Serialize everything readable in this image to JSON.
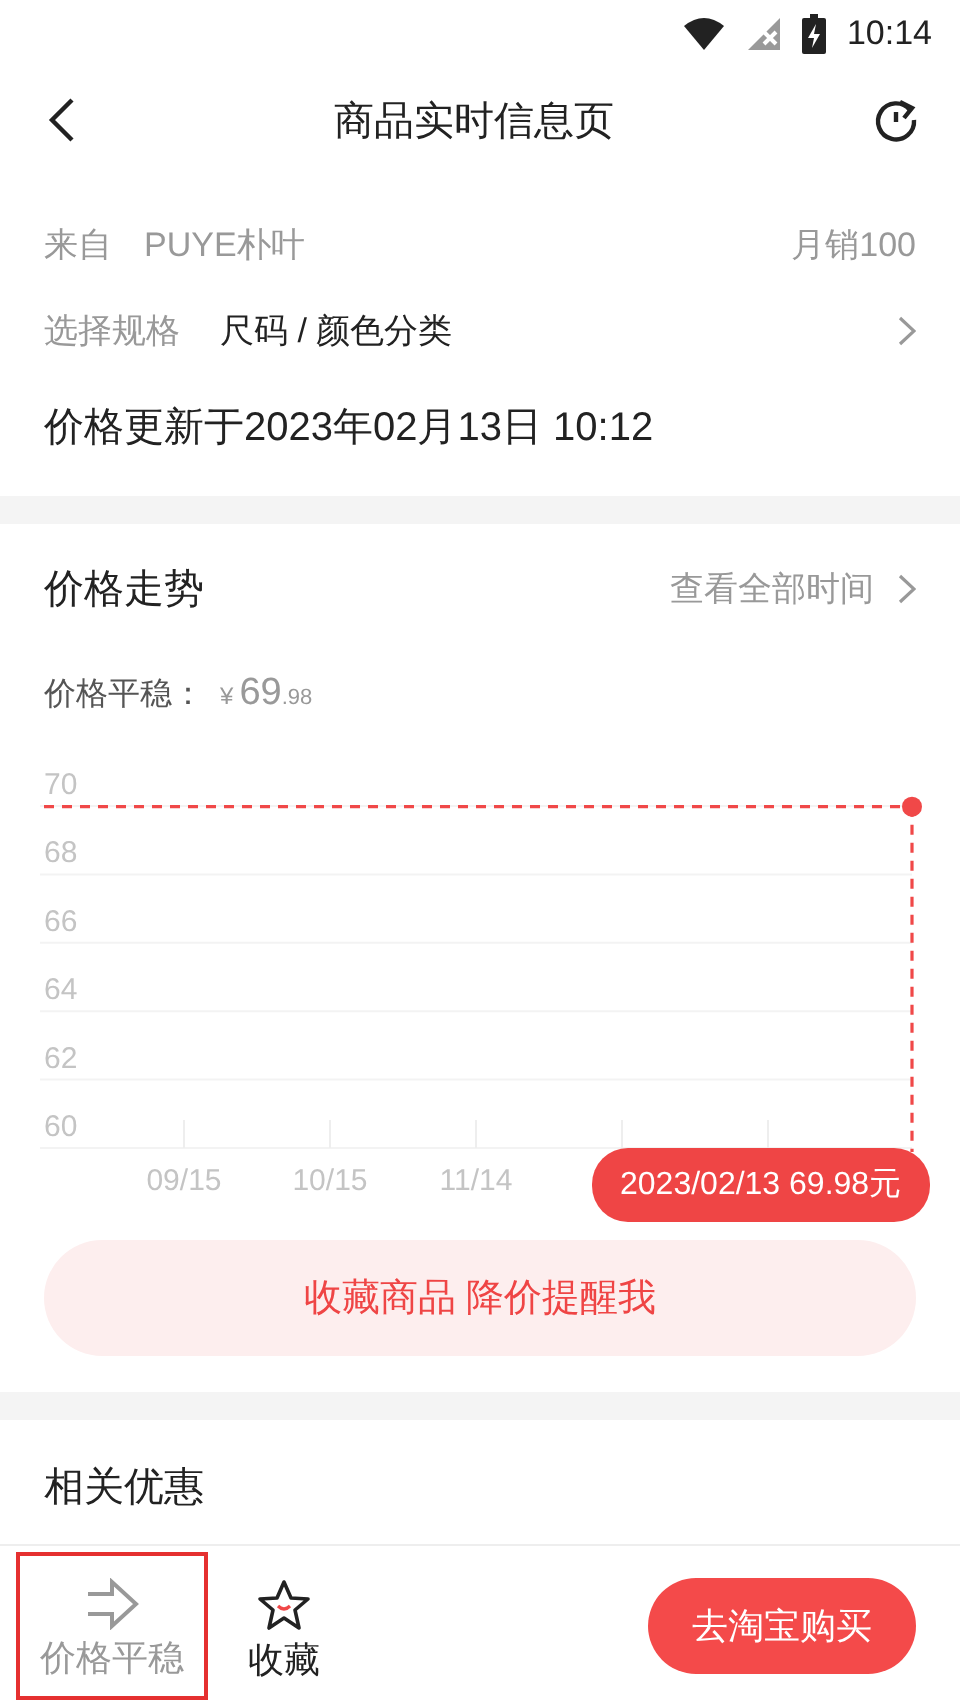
{
  "status_bar": {
    "time": "10:14"
  },
  "header": {
    "title": "商品实时信息页"
  },
  "product": {
    "source_label": "来自",
    "shop": "PUYE朴叶",
    "monthly_sales": "月销100",
    "spec_label": "选择规格",
    "spec_value": "尺码 / 颜色分类",
    "updated": "价格更新于2023年02月13日 10:12"
  },
  "trend": {
    "title": "价格走势",
    "link": "查看全部时间",
    "status_label": "价格平稳：",
    "currency": "¥",
    "price_int": "69",
    "price_dec": ".98",
    "chart_data": {
      "type": "line",
      "categories": [
        "09/15",
        "10/15",
        "11/14"
      ],
      "ylim": [
        60,
        70
      ],
      "yticks": [
        60,
        62,
        64,
        66,
        68,
        70
      ],
      "grid": true,
      "series": [
        {
          "color": "#f04848",
          "line_style": "dashed",
          "values": [
            69.98,
            69.98,
            69.98
          ]
        }
      ]
    },
    "tooltip": "2023/02/13 69.98元",
    "alert_button": "收藏商品 降价提醒我"
  },
  "offers": {
    "title": "相关优惠"
  },
  "bottom_bar": {
    "items": [
      {
        "kind": "trend",
        "label": "价格平稳",
        "highlighted": true
      },
      {
        "kind": "favorite",
        "label": "收藏",
        "highlighted": false
      }
    ],
    "buy_button": "去淘宝购买"
  }
}
